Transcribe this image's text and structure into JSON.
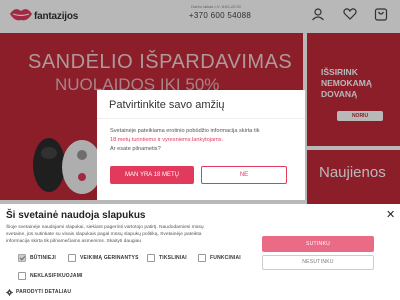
{
  "header": {
    "logo_text": "fantazijos",
    "hours": "Darbo laikas I-V: 8:00-22:00",
    "phone": "+370 600 54088",
    "icons": [
      "user-icon",
      "heart-icon",
      "cart-icon"
    ]
  },
  "banners": {
    "main_title": "SANDĖLIO IŠPARDAVIMAS",
    "main_sub": "NUOLAIDOS IKI 50%",
    "side_lines": [
      "IŠSIRINK",
      "NEMOKAMĄ",
      "DOVANĄ"
    ],
    "side_button": "NORIU",
    "side2_text": "Naujienos"
  },
  "age_modal": {
    "title": "Patvirtinkite savo amžių",
    "text_line1": "Svetainėje pateikiama erotinio pobūdžio informacija skirta tik",
    "text_highlight": "18 metų turintiems ir vyresniems lankytojams.",
    "question": "Ar esate pilnametis?",
    "yes_label": "MAN YRA 18 METŲ",
    "no_label": "NE"
  },
  "cookie": {
    "title": "Ši svetainė naudoja slapukus",
    "text_lines": [
      "Šioje svetainėje naudojami slapukai, siekiant pagerinti vartotojo patirtį. Naudodamiesi mūsų",
      "svetaine, jūs sutinkate su visais slapukais pagal mūsų slapukų politiką. Svetainėje pateikta",
      "informacija skirta tik pilnamečiams asmenims. Skaityti daugiau"
    ],
    "options": [
      {
        "label": "BŪTINIEJI",
        "checked": true
      },
      {
        "label": "VEIKIMĄ GERINANTYS",
        "checked": false
      },
      {
        "label": "TIKSLINIAI",
        "checked": false
      },
      {
        "label": "FUNKCINIAI",
        "checked": false
      },
      {
        "label": "NEKLASIFIKUOJAMI",
        "checked": false
      }
    ],
    "details_label": "PARODYTI DETALIAU",
    "accept_label": "SUTINKU",
    "decline_label": "NESUTINKU",
    "accent_color": "#ea6b86"
  },
  "colors": {
    "brand_red": "#c22a3a",
    "accent_pink": "#e23a5c"
  }
}
